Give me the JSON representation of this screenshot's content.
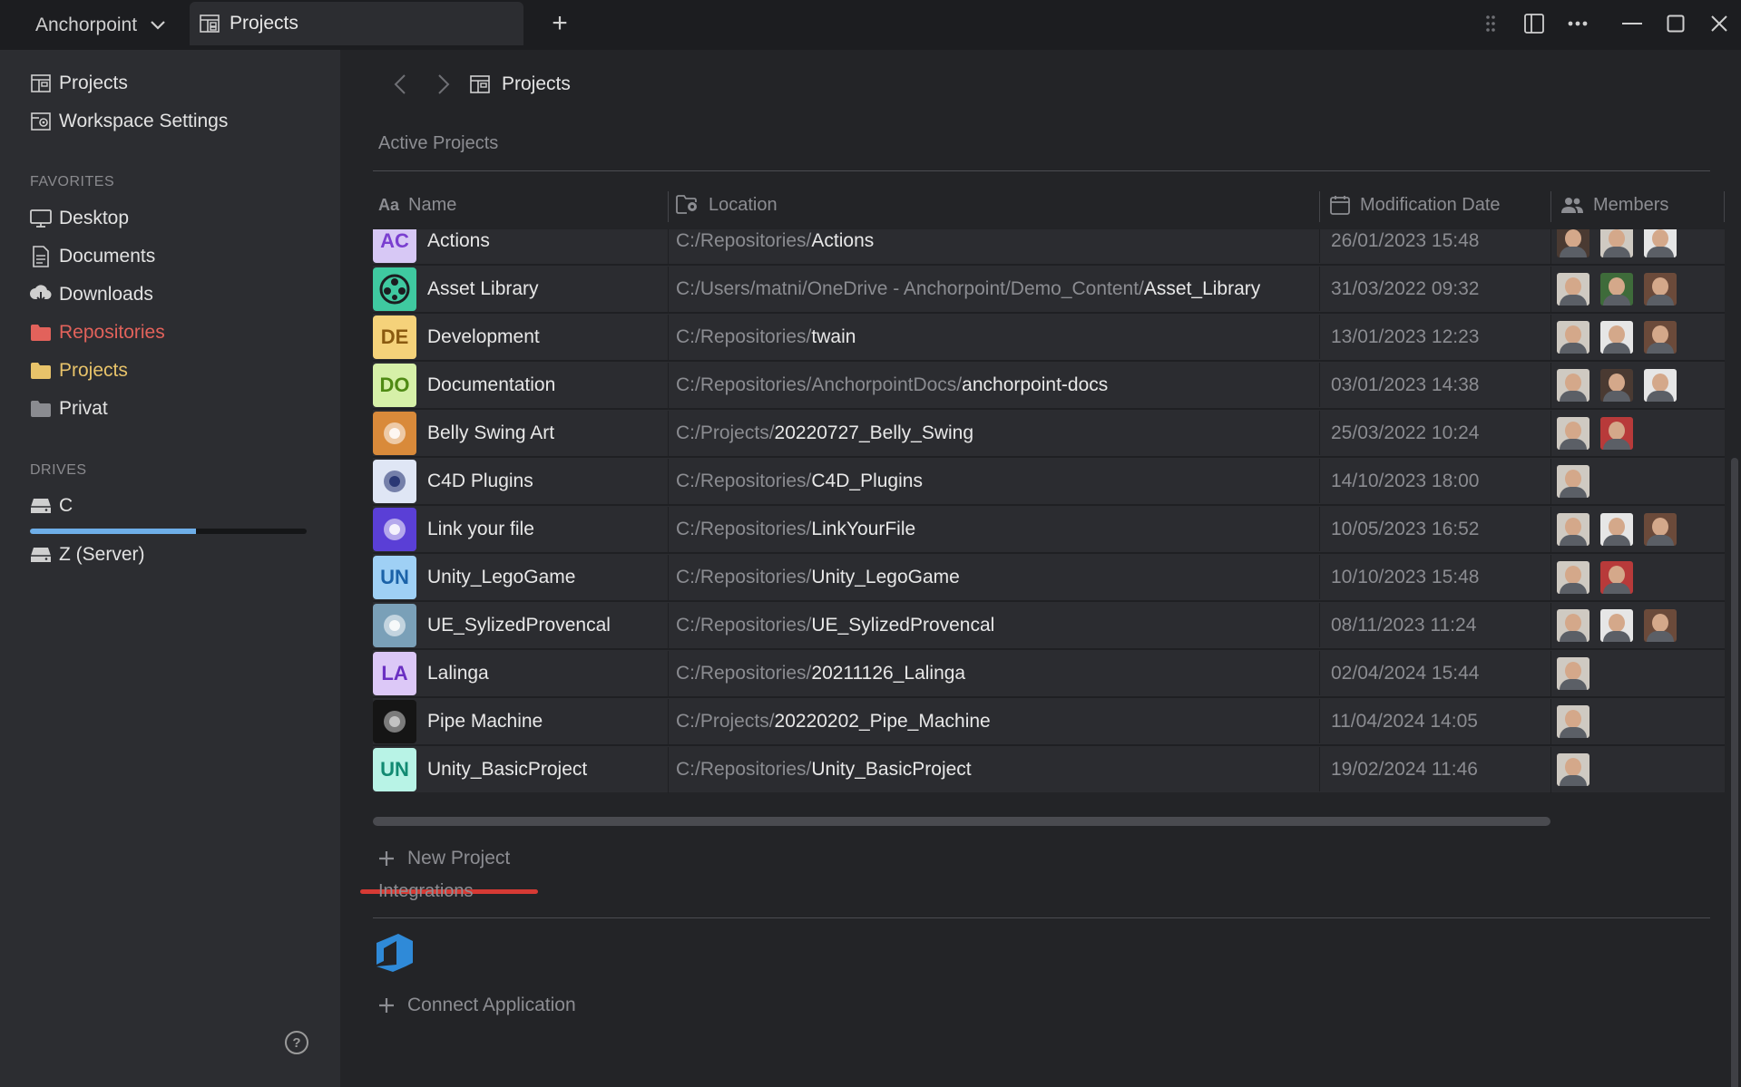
{
  "titlebar": {
    "workspace": "Anchorpoint",
    "tab_label": "Projects",
    "add_tab": "+"
  },
  "sidebar": {
    "top_items": [
      {
        "label": "Projects",
        "icon": "projects-icon"
      },
      {
        "label": "Workspace Settings",
        "icon": "workspace-settings-icon"
      }
    ],
    "favorites_heading": "FAVORITES",
    "favorites": [
      {
        "label": "Desktop",
        "icon": "desktop-icon",
        "color": "#e2e2e2"
      },
      {
        "label": "Documents",
        "icon": "document-icon",
        "color": "#e2e2e2"
      },
      {
        "label": "Downloads",
        "icon": "download-icon",
        "color": "#e2e2e2"
      },
      {
        "label": "Repositories",
        "icon": "folder-icon",
        "color": "#e2625b"
      },
      {
        "label": "Projects",
        "icon": "folder-icon",
        "color": "#e8c36a"
      },
      {
        "label": "Privat",
        "icon": "folder-icon",
        "color": "#e2e2e2"
      }
    ],
    "drives_heading": "DRIVES",
    "drives": [
      {
        "label": "C",
        "icon": "drive-icon",
        "usage": 0.6
      },
      {
        "label": "Z (Server)",
        "icon": "drive-icon"
      }
    ],
    "help": "?"
  },
  "main": {
    "breadcrumb": "Projects",
    "active_heading": "Active Projects",
    "columns": [
      "Name",
      "Location",
      "Modification Date",
      "Members"
    ],
    "projects": [
      {
        "name": "Actions",
        "thumb": "AC",
        "thumb_bg": "#d7c8f5",
        "thumb_fg": "#7a3fd0",
        "path_prefix": "C:/Repositories/",
        "path_main": "Actions",
        "date": "26/01/2023 15:48",
        "members": [
          "av-b",
          "av-a",
          "av-c"
        ]
      },
      {
        "name": "Asset Library",
        "thumb": "icon",
        "thumb_bg": "#3fc9a0",
        "thumb_fg": "#1c1d20",
        "path_prefix": "C:/Users/matni/OneDrive - Anchorpoint/Demo_Content/",
        "path_main": "Asset_Library",
        "date": "31/03/2022 09:32",
        "members": [
          "av-a",
          "av-f",
          "av-d"
        ]
      },
      {
        "name": "Development",
        "thumb": "DE",
        "thumb_bg": "#f5d27a",
        "thumb_fg": "#8a5a10",
        "path_prefix": "C:/Repositories/",
        "path_main": "twain",
        "date": "13/01/2023 12:23",
        "members": [
          "av-a",
          "av-c",
          "av-d"
        ]
      },
      {
        "name": "Documentation",
        "thumb": "DO",
        "thumb_bg": "#d6f0a8",
        "thumb_fg": "#4f8a14",
        "path_prefix": "C:/Repositories/AnchorpointDocs/",
        "path_main": "anchorpoint-docs",
        "date": "03/01/2023 14:38",
        "members": [
          "av-a",
          "av-b",
          "av-c"
        ]
      },
      {
        "name": "Belly Swing Art",
        "thumb": "img",
        "thumb_bg": "#d98a3a",
        "thumb_fg": "#ffffff",
        "path_prefix": "C:/Projects/",
        "path_main": "20220727_Belly_Swing",
        "date": "25/03/2022 10:24",
        "members": [
          "av-a",
          "av-e"
        ]
      },
      {
        "name": "C4D Plugins",
        "thumb": "img",
        "thumb_bg": "#dfe6f5",
        "thumb_fg": "#1d2c6b",
        "path_prefix": "C:/Repositories/",
        "path_main": "C4D_Plugins",
        "date": "14/10/2023 18:00",
        "members": [
          "av-a"
        ]
      },
      {
        "name": "Link your file",
        "thumb": "img",
        "thumb_bg": "#5a3fd6",
        "thumb_fg": "#ffffff",
        "path_prefix": "C:/Repositories/",
        "path_main": "LinkYourFile",
        "date": "10/05/2023 16:52",
        "members": [
          "av-a",
          "av-c",
          "av-d"
        ]
      },
      {
        "name": "Unity_LegoGame",
        "thumb": "UN",
        "thumb_bg": "#9fd0f5",
        "thumb_fg": "#1b62a8",
        "path_prefix": "C:/Repositories/",
        "path_main": "Unity_LegoGame",
        "date": "10/10/2023 15:48",
        "members": [
          "av-a",
          "av-e"
        ]
      },
      {
        "name": "UE_SylizedProvencal",
        "thumb": "img",
        "thumb_bg": "#7aa0b8",
        "thumb_fg": "#ffffff",
        "path_prefix": "C:/Repositories/",
        "path_main": "UE_SylizedProvencal",
        "date": "08/11/2023 11:24",
        "members": [
          "av-a",
          "av-c",
          "av-d"
        ]
      },
      {
        "name": "Lalinga",
        "thumb": "LA",
        "thumb_bg": "#dcc8f7",
        "thumb_fg": "#6a2fc2",
        "path_prefix": "C:/Repositories/",
        "path_main": "20211126_Lalinga",
        "date": "02/04/2024 15:44",
        "members": [
          "av-a"
        ]
      },
      {
        "name": "Pipe Machine",
        "thumb": "img",
        "thumb_bg": "#151515",
        "thumb_fg": "#cfcfcf",
        "path_prefix": "C:/Projects/",
        "path_main": "20220202_Pipe_Machine",
        "date": "11/04/2024 14:05",
        "members": [
          "av-a"
        ]
      },
      {
        "name": "Unity_BasicProject",
        "thumb": "UN",
        "thumb_bg": "#b8f3e6",
        "thumb_fg": "#128a72",
        "path_prefix": "C:/Repositories/",
        "path_main": "Unity_BasicProject",
        "date": "19/02/2024 11:46",
        "members": [
          "av-a"
        ]
      }
    ],
    "new_project": "New Project",
    "integrations_heading": "Integrations",
    "connect_app": "Connect Application"
  },
  "colors": {
    "accent_red": "#d63a34",
    "azure_blue": "#2f8ad8"
  }
}
